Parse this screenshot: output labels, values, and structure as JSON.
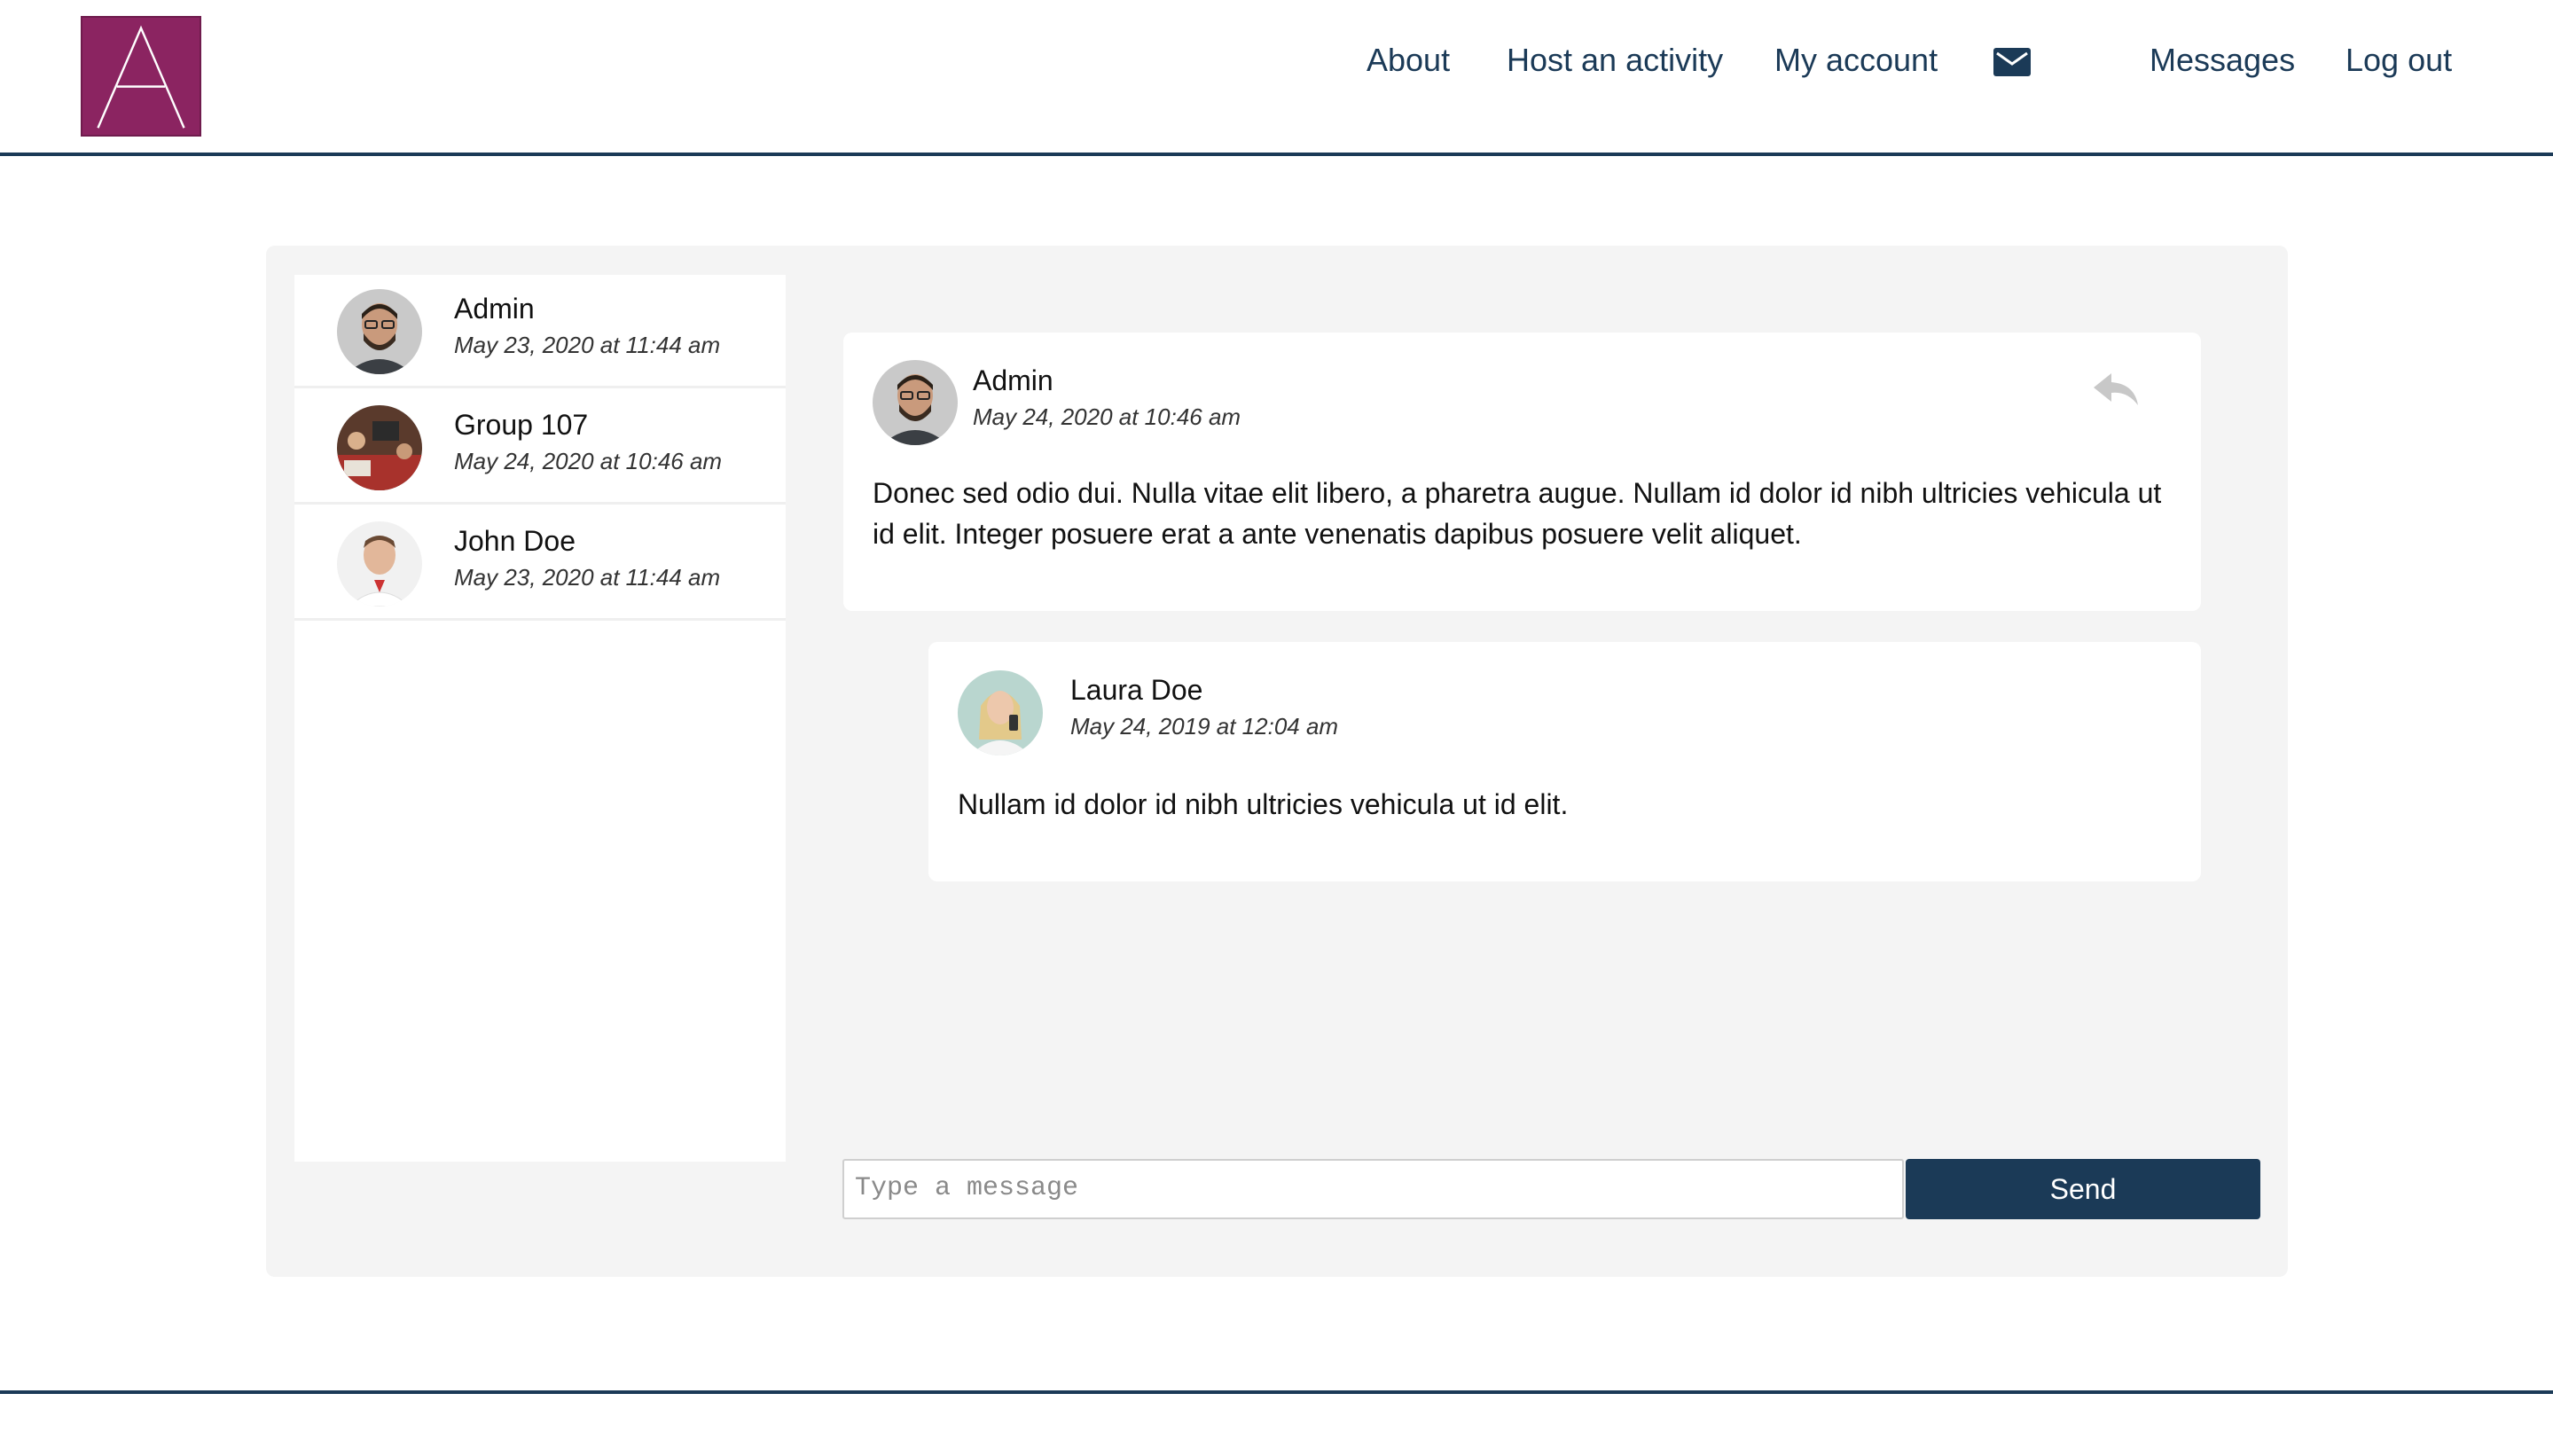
{
  "header": {
    "logo_letter": "A",
    "logo_color": "#8b2461",
    "nav": {
      "about": "About",
      "host": "Host an activity",
      "account": "My account",
      "mail_icon": "envelope-icon",
      "messages": "Messages",
      "logout": "Log out"
    },
    "accent_color": "#1b3a57"
  },
  "conversations": [
    {
      "name": "Admin",
      "date": "May 23, 2020 at 11:44 am",
      "avatar": "man-glasses-avatar"
    },
    {
      "name": "Group 107",
      "date": "May 24, 2020 at 10:46 am",
      "avatar": "group-photo-avatar"
    },
    {
      "name": "John Doe",
      "date": "May 23, 2020 at 11:44 am",
      "avatar": "man-avatar"
    }
  ],
  "messages": [
    {
      "author": "Admin",
      "date": "May 24, 2020 at 10:46 am",
      "body": "Donec sed odio dui. Nulla vitae elit libero, a pharetra augue. Nullam id dolor id nibh ultricies vehicula ut id elit. Integer posuere erat a ante venenatis dapibus posuere velit aliquet.",
      "reply_icon": "reply-arrow-icon"
    },
    {
      "author": "Laura Doe",
      "date": "May 24, 2019 at 12:04 am",
      "body": "Nullam id dolor id nibh ultricies vehicula ut id elit."
    }
  ],
  "composer": {
    "placeholder": "Type a message",
    "value": "",
    "send_label": "Send"
  }
}
